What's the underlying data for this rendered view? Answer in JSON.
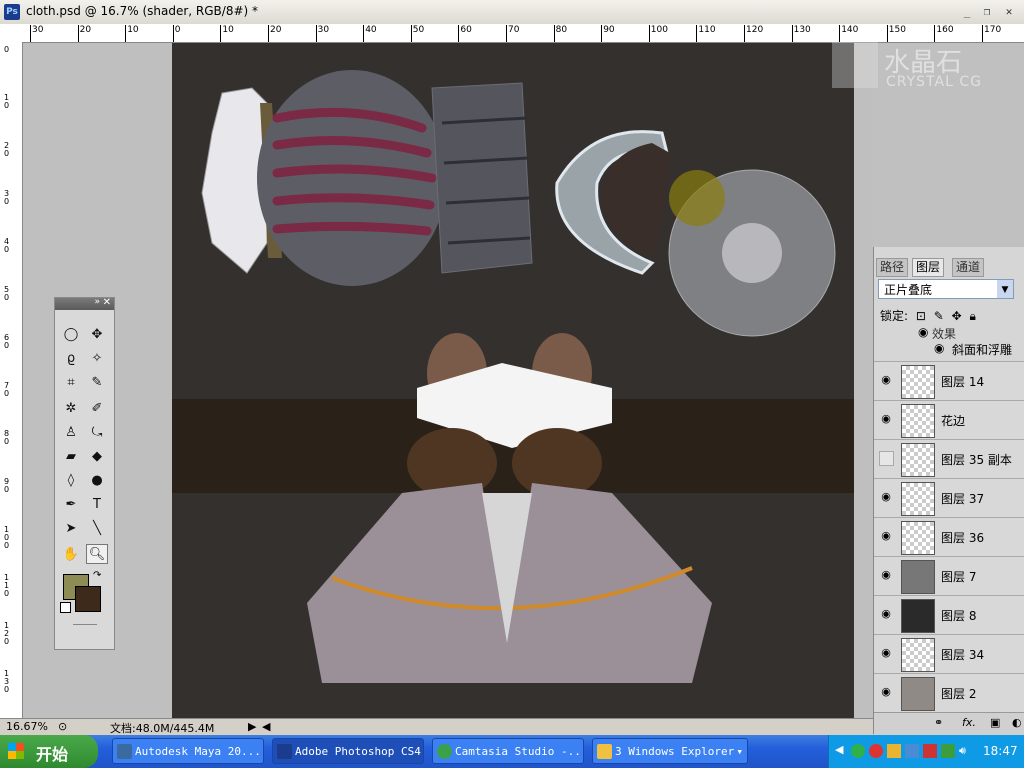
{
  "window": {
    "title": "cloth.psd @ 16.7% (shader, RGB/8#) *",
    "app_icon": "Ps"
  },
  "ruler_top_labels": [
    "30",
    "20",
    "10",
    "0",
    "10",
    "20",
    "30",
    "40",
    "50",
    "60",
    "70",
    "80",
    "90",
    "100",
    "110",
    "120",
    "130",
    "140",
    "150",
    "160",
    "170"
  ],
  "ruler_left_labels": [
    "0",
    "1 0",
    "2 0",
    "3 0",
    "4 0",
    "5 0",
    "6 0",
    "7 0",
    "8 0",
    "9 0",
    "1 0 0",
    "1 1 0",
    "1 2 0",
    "1 3 0"
  ],
  "watermark": {
    "main": "水晶石",
    "sub": "CRYSTAL CG"
  },
  "layers_panel": {
    "tabs": [
      "路径",
      "图层",
      "通道"
    ],
    "active_tab": "图层",
    "blend_mode": "正片叠底",
    "lock_label": "锁定:",
    "effects": [
      "效果",
      "斜面和浮雕"
    ],
    "layers": [
      {
        "name": "图层 14",
        "visible": true
      },
      {
        "name": "花边",
        "visible": true
      },
      {
        "name": "图层 35 副本",
        "visible": false
      },
      {
        "name": "图层 37",
        "visible": true
      },
      {
        "name": "图层 36",
        "visible": true
      },
      {
        "name": "图层 7",
        "visible": true
      },
      {
        "name": "图层 8",
        "visible": true
      },
      {
        "name": "图层 34",
        "visible": true
      },
      {
        "name": "图层 2",
        "visible": true
      }
    ],
    "footer_fx": "fx."
  },
  "statusbar": {
    "zoom": "16.67%",
    "doc_info": "文档:48.0M/445.4M"
  },
  "taskbar": {
    "start_label": "开始",
    "items": [
      {
        "label": "Autodesk Maya 20...",
        "active": false
      },
      {
        "label": "Adobe Photoshop CS4",
        "active": true
      },
      {
        "label": "Camtasia Studio -...",
        "active": false
      },
      {
        "label": "3 Windows Explorer",
        "active": false
      }
    ],
    "clock": "18:47"
  },
  "colors": {
    "foreground": "#8d8c54",
    "background": "#3d2a1b",
    "canvas": "#34302e"
  }
}
